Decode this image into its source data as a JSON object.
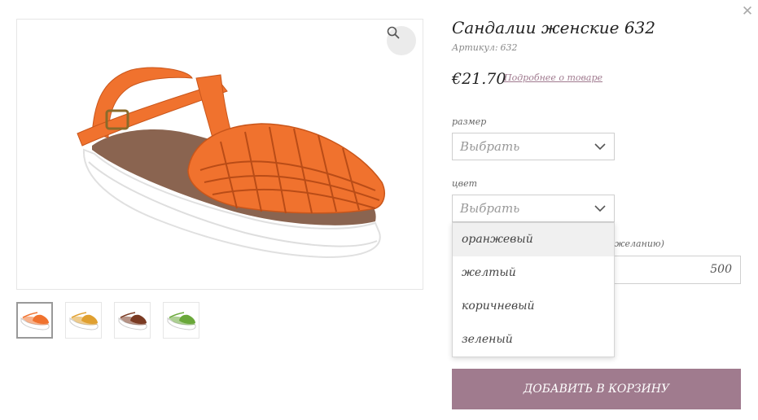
{
  "product": {
    "title": "Сандалии женские 632",
    "sku_label": "Артикул:",
    "sku": "632",
    "price": "€21.70",
    "more_link": "Подробнее о товаре",
    "main_image_icon": "orange-sandal-photo",
    "zoom_icon": "search-icon",
    "close_icon": "close-icon"
  },
  "gallery": {
    "thumbnails": [
      {
        "name": "orange",
        "color": "#f0722e",
        "active": true
      },
      {
        "name": "yellow",
        "color": "#e0a030",
        "active": false
      },
      {
        "name": "brown",
        "color": "#7a3a22",
        "active": false
      },
      {
        "name": "green",
        "color": "#6aa83a",
        "active": false
      }
    ]
  },
  "options": {
    "size": {
      "label": "размер",
      "placeholder": "Выбрать"
    },
    "color": {
      "label": "цвет",
      "placeholder": "Выбрать",
      "dropdown": [
        "оранжевый",
        "желтый",
        "коричневый",
        "зеленый"
      ],
      "highlighted_index": 0
    },
    "partially_hidden_label": "желанию)",
    "amount_value": "500"
  },
  "cart": {
    "add_button": "ДОБАВИТЬ В КОРЗИНУ"
  },
  "colors": {
    "accent": "#a07b8e",
    "link": "#a07a8f",
    "sandal_orange": "#f0722e",
    "sole": "#ffffff"
  }
}
